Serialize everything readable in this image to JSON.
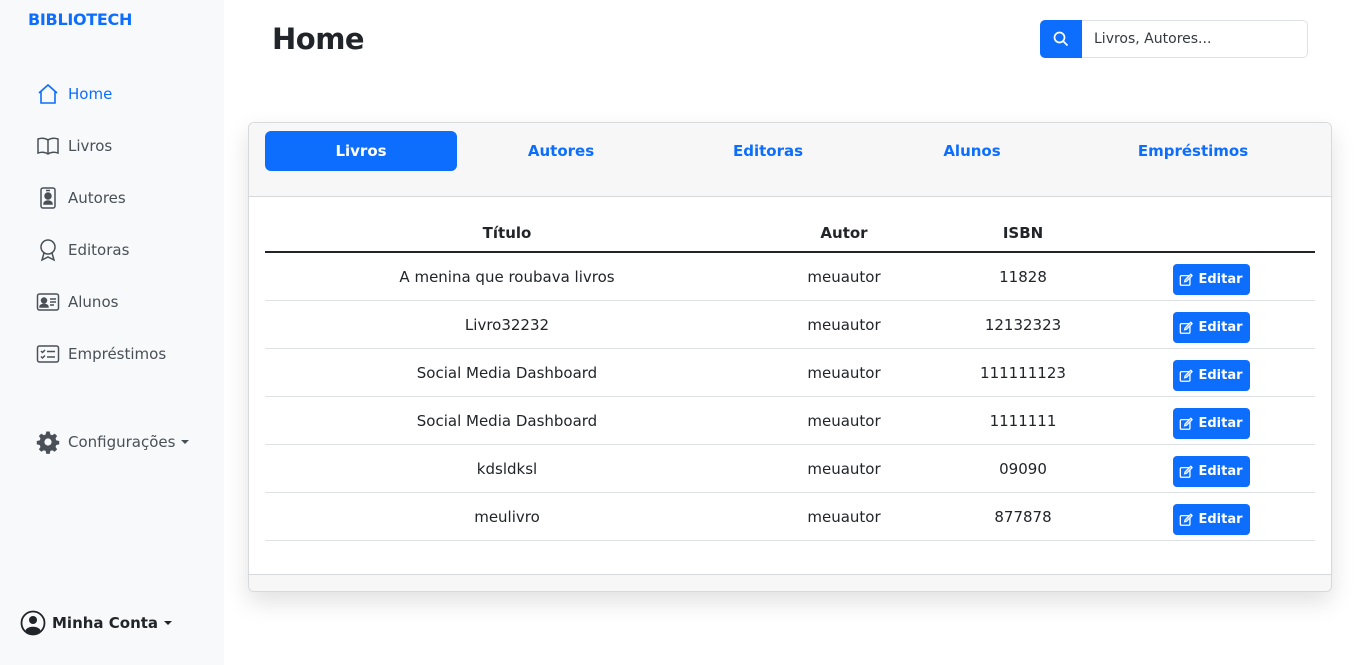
{
  "brand": "BIBLIOTECH",
  "colors": {
    "accent": "#0d6efd",
    "sidebar_bg": "#f8f9fa",
    "text": "#212529"
  },
  "sidebar": {
    "items": [
      {
        "label": "Home",
        "icon": "home-icon",
        "active": true
      },
      {
        "label": "Livros",
        "icon": "book-icon",
        "active": false
      },
      {
        "label": "Autores",
        "icon": "person-badge-icon",
        "active": false
      },
      {
        "label": "Editoras",
        "icon": "award-icon",
        "active": false
      },
      {
        "label": "Alunos",
        "icon": "person-vcard-icon",
        "active": false
      },
      {
        "label": "Empréstimos",
        "icon": "checklist-icon",
        "active": false
      }
    ],
    "config_label": "Configurações",
    "account_label": "Minha Conta"
  },
  "header": {
    "title": "Home",
    "search": {
      "placeholder": "Livros, Autores...",
      "icon": "search-icon"
    }
  },
  "tabs": [
    {
      "label": "Livros",
      "active": true
    },
    {
      "label": "Autores",
      "active": false
    },
    {
      "label": "Editoras",
      "active": false
    },
    {
      "label": "Alunos",
      "active": false
    },
    {
      "label": "Empréstimos",
      "active": false
    }
  ],
  "table": {
    "columns": [
      "Título",
      "Autor",
      "ISBN",
      ""
    ],
    "edit_label": "Editar",
    "rows": [
      {
        "titulo": "A menina que roubava livros",
        "autor": "meuautor",
        "isbn": "11828"
      },
      {
        "titulo": "Livro32232",
        "autor": "meuautor",
        "isbn": "12132323"
      },
      {
        "titulo": "Social Media Dashboard",
        "autor": "meuautor",
        "isbn": "111111123"
      },
      {
        "titulo": "Social Media Dashboard",
        "autor": "meuautor",
        "isbn": "1111111"
      },
      {
        "titulo": "kdsldksl",
        "autor": "meuautor",
        "isbn": "09090"
      },
      {
        "titulo": "meulivro",
        "autor": "meuautor",
        "isbn": "877878"
      }
    ]
  }
}
